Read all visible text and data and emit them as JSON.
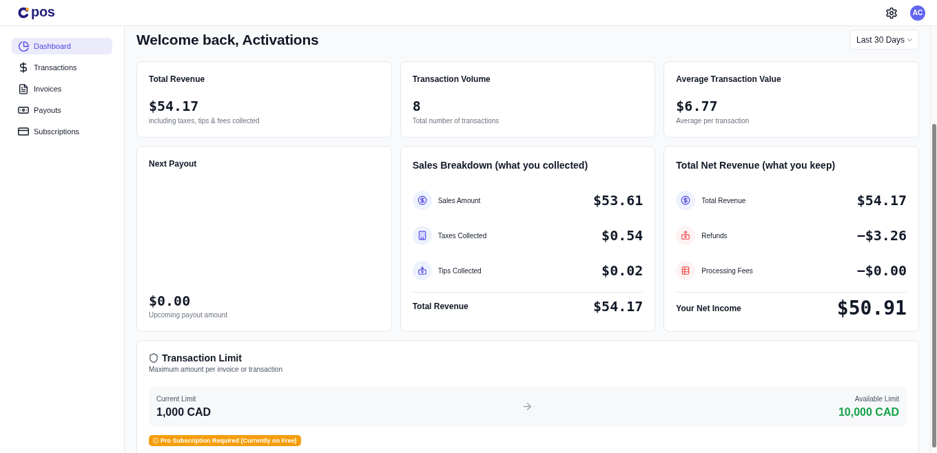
{
  "header": {
    "logo": "pos",
    "avatar": "AC"
  },
  "sidebar": {
    "items": [
      {
        "label": "Dashboard",
        "selected": true
      },
      {
        "label": "Transactions",
        "selected": false
      },
      {
        "label": "Invoices",
        "selected": false
      },
      {
        "label": "Payouts",
        "selected": false
      },
      {
        "label": "Subscriptions",
        "selected": false
      }
    ]
  },
  "page": {
    "title": "Welcome back, Activations",
    "range_selector": "Last 30 Days"
  },
  "stats": [
    {
      "title": "Total Revenue",
      "value": "$54.17",
      "caption": "including taxes, tips & fees collected"
    },
    {
      "title": "Transaction Volume",
      "value": "8",
      "caption": "Total number of transactions"
    },
    {
      "title": "Average Transaction Value",
      "value": "$6.77",
      "caption": "Average per transaction"
    }
  ],
  "next_payout": {
    "title": "Next Payout",
    "value": "$0.00",
    "caption": "Upcoming payout amount"
  },
  "sales_breakdown": {
    "title": "Sales Breakdown (what you collected)",
    "rows": [
      {
        "label": "Sales Amount",
        "value": "$53.61",
        "kind": "income"
      },
      {
        "label": "Taxes Collected",
        "value": "$0.54",
        "kind": "income"
      },
      {
        "label": "Tips Collected",
        "value": "$0.02",
        "kind": "income"
      }
    ],
    "total": {
      "label": "Total Revenue",
      "value": "$54.17"
    }
  },
  "net_revenue": {
    "title": "Total Net Revenue (what you keep)",
    "rows": [
      {
        "label": "Total Revenue",
        "value": "$54.17",
        "kind": "income"
      },
      {
        "label": "Refunds",
        "value": "−$3.26",
        "kind": "deduction"
      },
      {
        "label": "Processing Fees",
        "value": "−$0.00",
        "kind": "deduction"
      }
    ],
    "total": {
      "label": "Your Net Income",
      "value": "$50.91"
    }
  },
  "transaction_limit": {
    "title": "Transaction Limit",
    "subtitle": "Maximum amount per invoice or transaction",
    "current": {
      "label": "Current Limit",
      "value": "1,000 CAD"
    },
    "available": {
      "label": "Available Limit",
      "value": "10,000 CAD"
    },
    "badge": "Pro Subscription Required (Currently on Free)"
  }
}
